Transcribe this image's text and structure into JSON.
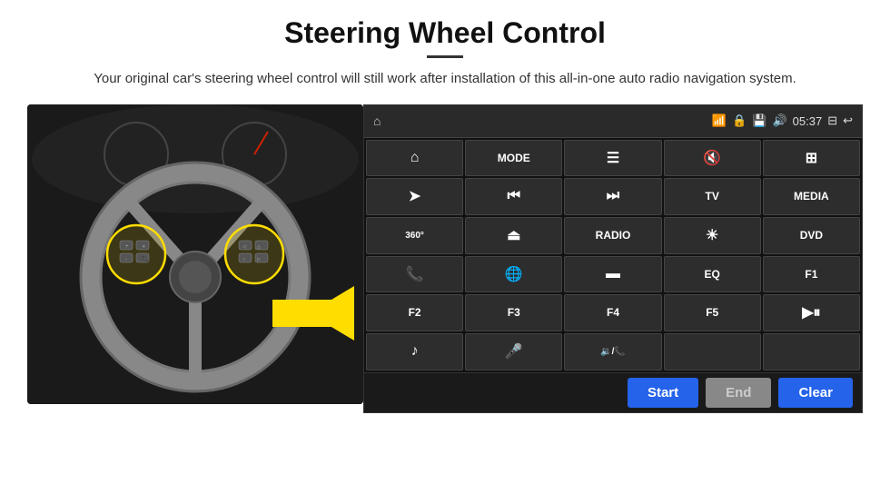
{
  "header": {
    "title": "Steering Wheel Control",
    "subtitle": "Your original car's steering wheel control will still work after installation of this all-in-one auto radio navigation system."
  },
  "topbar": {
    "time": "05:37"
  },
  "buttons": [
    {
      "id": "nav",
      "icon": "⌂",
      "type": "icon"
    },
    {
      "id": "mode",
      "label": "MODE",
      "type": "text"
    },
    {
      "id": "list",
      "icon": "☰",
      "type": "icon"
    },
    {
      "id": "mute",
      "icon": "🔇",
      "type": "icon"
    },
    {
      "id": "apps",
      "icon": "⊞",
      "type": "icon"
    },
    {
      "id": "send",
      "icon": "➤",
      "type": "icon"
    },
    {
      "id": "prev",
      "icon": "⏮",
      "type": "icon"
    },
    {
      "id": "next",
      "icon": "⏭",
      "type": "icon"
    },
    {
      "id": "tv",
      "label": "TV",
      "type": "text"
    },
    {
      "id": "media",
      "label": "MEDIA",
      "type": "text"
    },
    {
      "id": "360",
      "icon": "360°",
      "type": "icon"
    },
    {
      "id": "eject",
      "icon": "⏏",
      "type": "icon"
    },
    {
      "id": "radio",
      "label": "RADIO",
      "type": "text"
    },
    {
      "id": "brightness",
      "icon": "☀",
      "type": "icon"
    },
    {
      "id": "dvd",
      "label": "DVD",
      "type": "text"
    },
    {
      "id": "phone",
      "icon": "📞",
      "type": "icon"
    },
    {
      "id": "internet",
      "icon": "🌐",
      "type": "icon"
    },
    {
      "id": "window",
      "icon": "▬",
      "type": "icon"
    },
    {
      "id": "eq",
      "label": "EQ",
      "type": "text"
    },
    {
      "id": "f1",
      "label": "F1",
      "type": "text"
    },
    {
      "id": "f2",
      "label": "F2",
      "type": "text"
    },
    {
      "id": "f3",
      "label": "F3",
      "type": "text"
    },
    {
      "id": "f4",
      "label": "F4",
      "type": "text"
    },
    {
      "id": "f5",
      "label": "F5",
      "type": "text"
    },
    {
      "id": "playpause",
      "icon": "▶⏸",
      "type": "icon"
    },
    {
      "id": "music",
      "icon": "♪",
      "type": "icon"
    },
    {
      "id": "mic",
      "icon": "🎤",
      "type": "icon"
    },
    {
      "id": "vol",
      "icon": "🔉/📞",
      "type": "icon"
    }
  ],
  "bottom_buttons": {
    "start": "Start",
    "end": "End",
    "clear": "Clear"
  }
}
